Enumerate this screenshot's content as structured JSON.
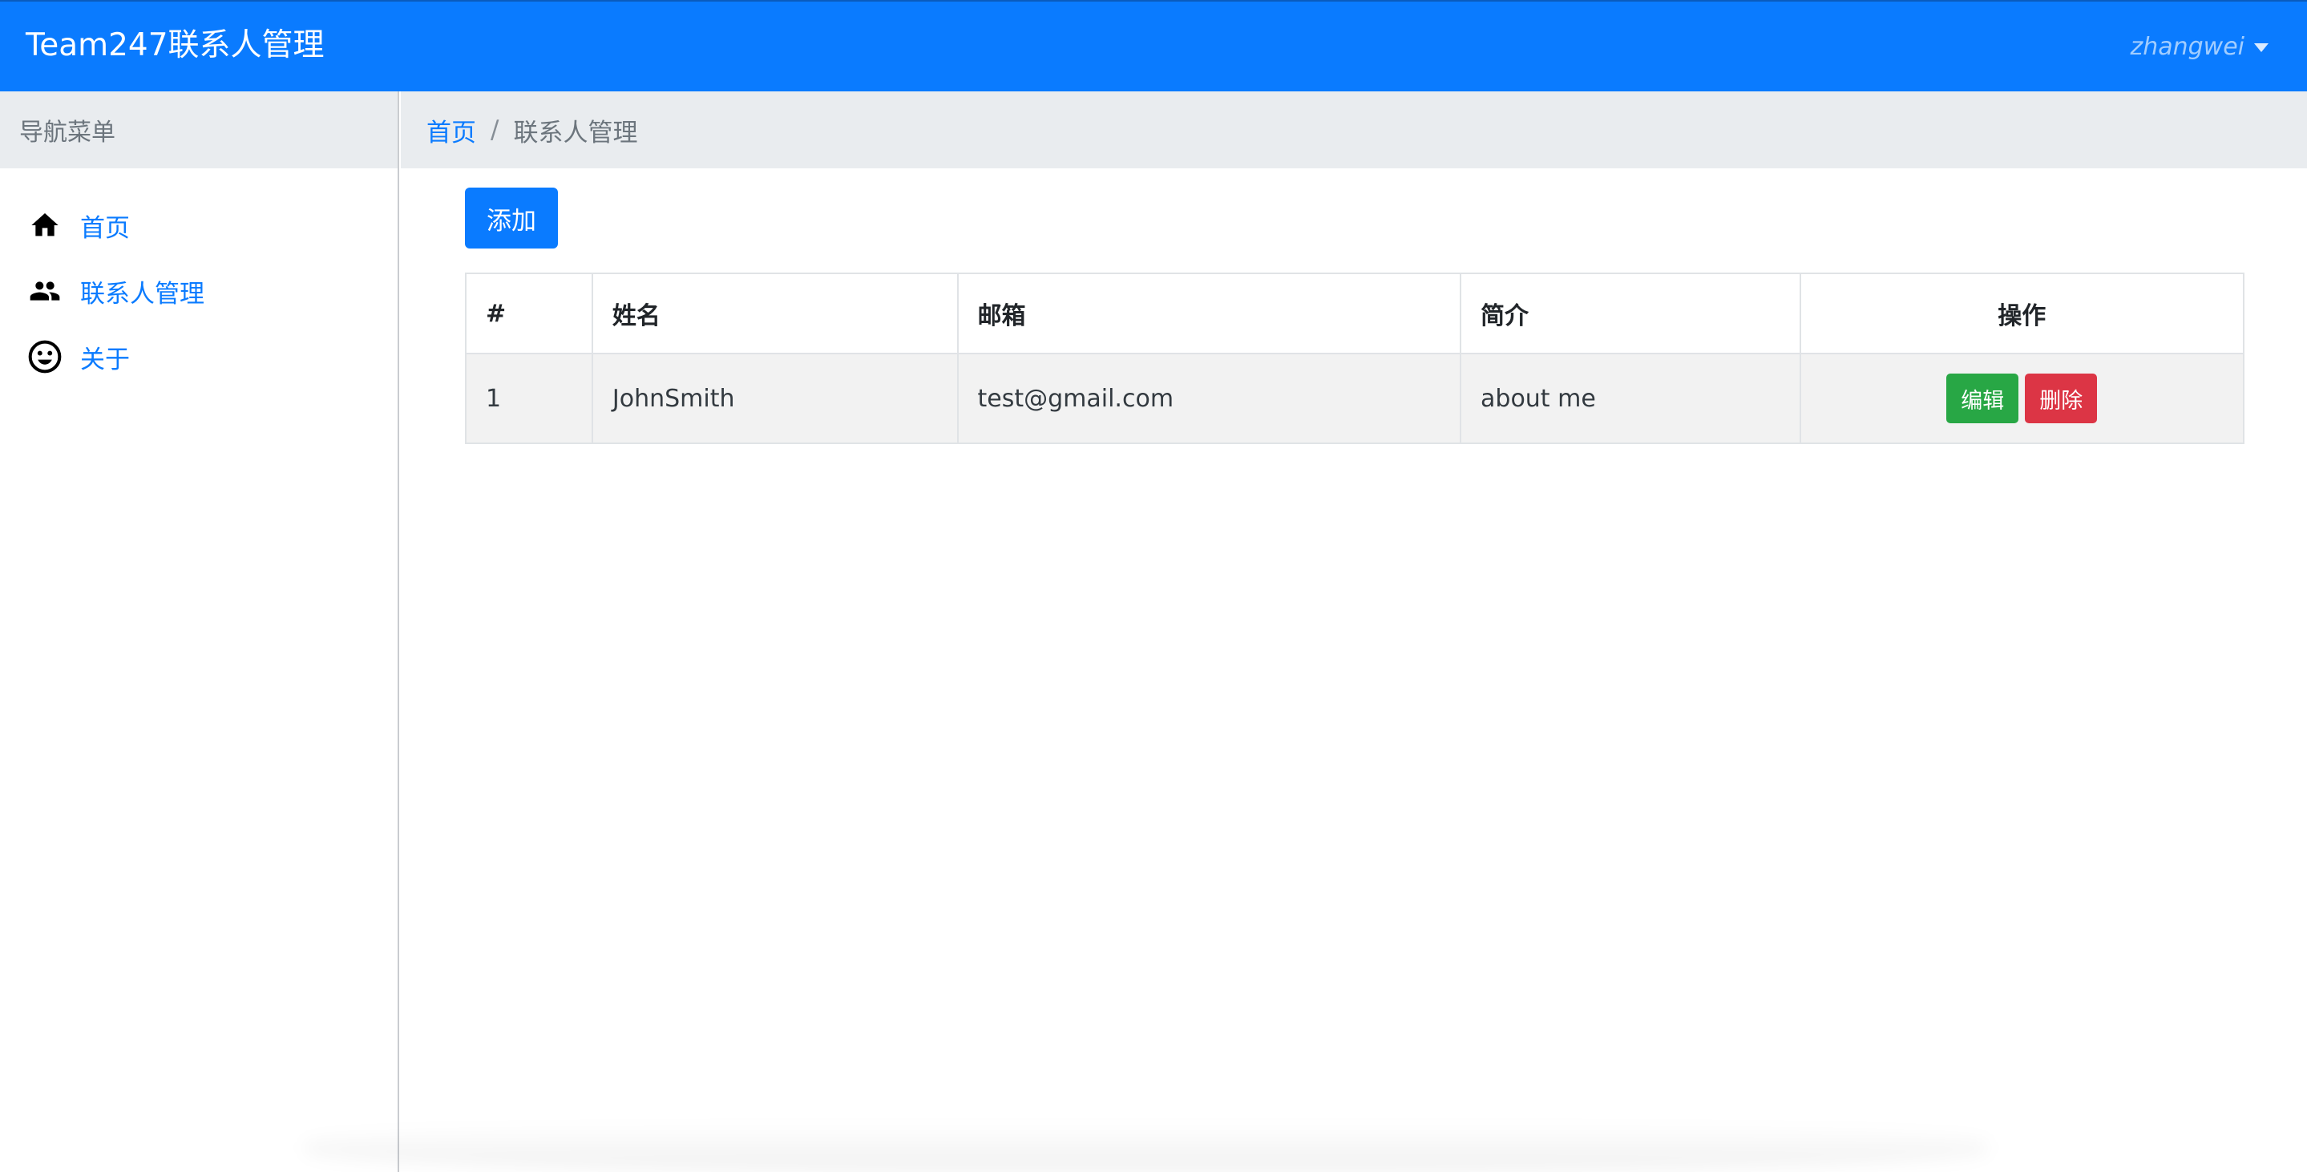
{
  "app": {
    "title": "Team247联系人管理",
    "user": "zhangwei"
  },
  "sidebar": {
    "header": "导航菜单",
    "items": [
      {
        "label": "首页",
        "icon": "home-icon"
      },
      {
        "label": "联系人管理",
        "icon": "people-icon"
      },
      {
        "label": "关于",
        "icon": "smiley-icon"
      }
    ]
  },
  "breadcrumb": {
    "home": "首页",
    "separator": "/",
    "current": "联系人管理"
  },
  "toolbar": {
    "add_label": "添加"
  },
  "table": {
    "headers": [
      "#",
      "姓名",
      "邮箱",
      "简介",
      "操作"
    ],
    "rows": [
      {
        "num": "1",
        "name": "JohnSmith",
        "email": "test@gmail.com",
        "bio": "about me",
        "edit_label": "编辑",
        "delete_label": "删除"
      }
    ]
  },
  "colors": {
    "primary": "#0a7bff",
    "success": "#28a745",
    "danger": "#dc3545"
  }
}
